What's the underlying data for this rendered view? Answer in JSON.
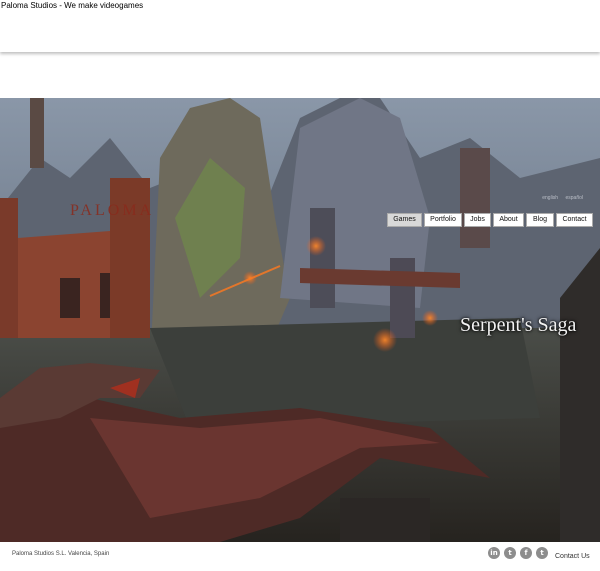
{
  "page": {
    "title": "Paloma Studios - We make videogames"
  },
  "hero": {
    "brand": "PALOMA",
    "languages": [
      "english",
      "español"
    ],
    "game_title": "Serpent's Saga"
  },
  "nav": {
    "items": [
      {
        "label": "Games",
        "active": true
      },
      {
        "label": "Portfolio"
      },
      {
        "label": "Jobs"
      },
      {
        "label": "About"
      },
      {
        "label": "Blog"
      },
      {
        "label": "Contact"
      }
    ]
  },
  "footer": {
    "company": "Paloma Studios S.L. Valencia, Spain",
    "social": [
      {
        "icon": "linkedin-icon",
        "glyph": "in"
      },
      {
        "icon": "twitter-icon",
        "glyph": "t"
      },
      {
        "icon": "facebook-icon",
        "glyph": "f"
      },
      {
        "icon": "tumblr-icon",
        "glyph": "t"
      }
    ],
    "contact": "Contact Us"
  }
}
